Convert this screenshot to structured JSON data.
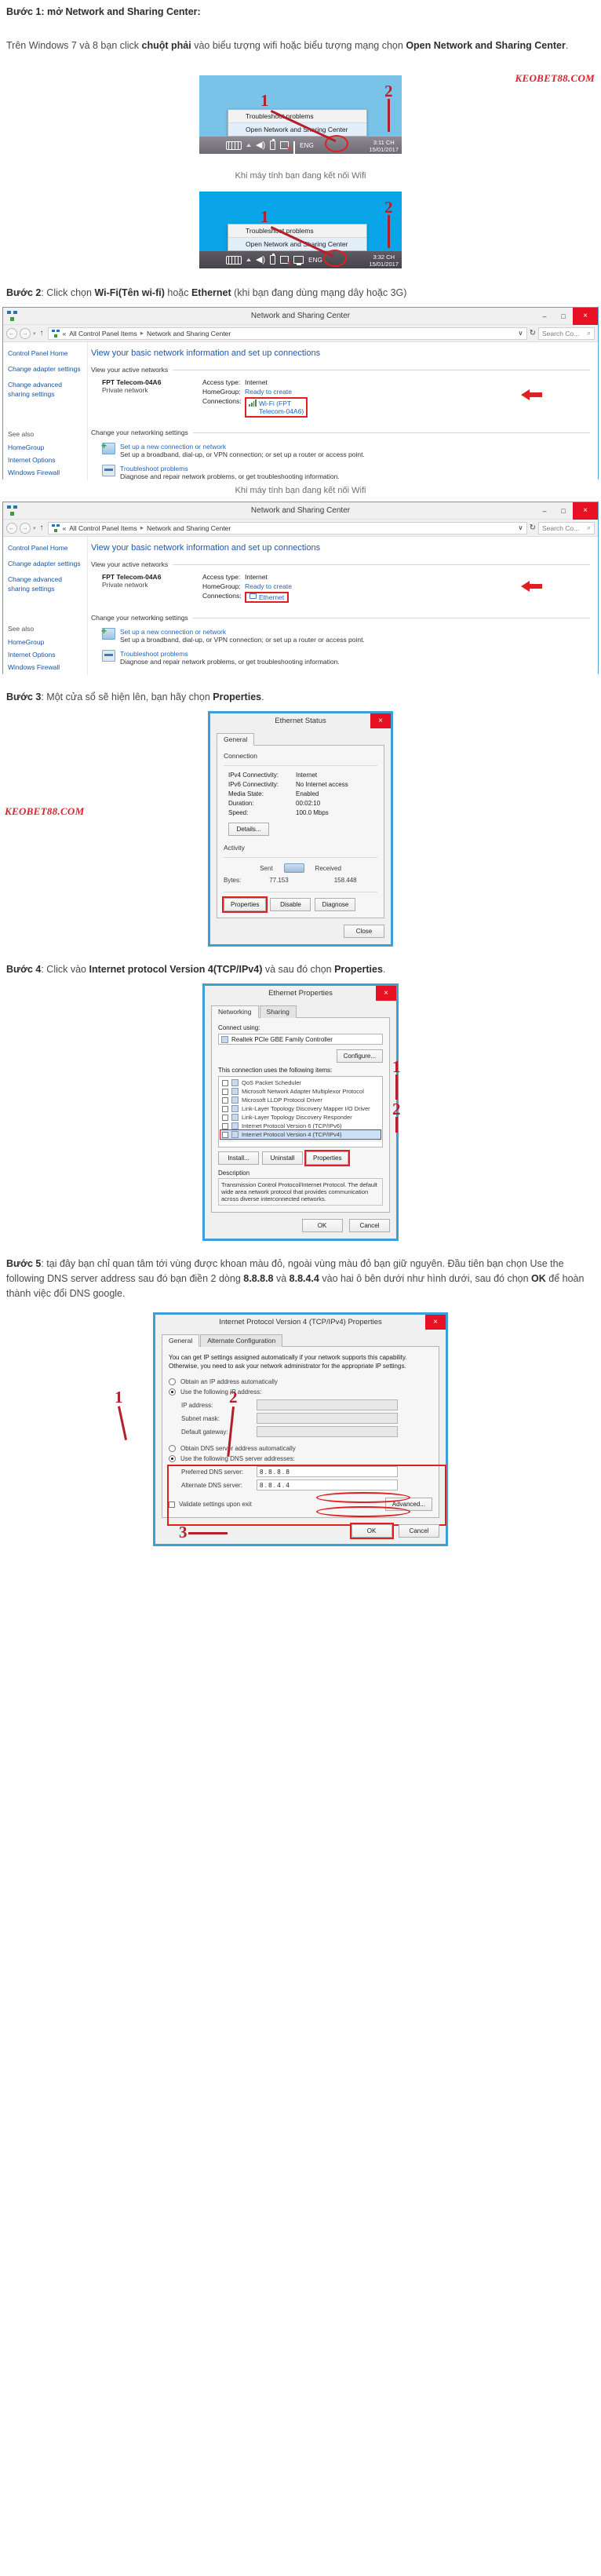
{
  "article": {
    "step1": {
      "label": "Bước 1",
      "title": ": mở Network and Sharing Center:",
      "body_pre": "Trên Windows 7 và 8 bạn click ",
      "body_bold1": "chuột phải",
      "body_mid": " vào biểu tượng wifi hoặc biểu tượng mạng chọn ",
      "body_bold2": "Open Network and Sharing Center",
      "body_end": "."
    },
    "step2": {
      "label": "Bước 2",
      "t1": ": Click chọn ",
      "b1": "Wi-Fi(Tên wi-fi)",
      "t2": " hoặc ",
      "b2": "Ethernet",
      "t3": " (khi bạn đang dùng mạng dây hoặc 3G)"
    },
    "step3": {
      "label": "Bước 3",
      "t1": ": Một cửa sổ sẽ hiện lên, bạn hãy chọn ",
      "b1": "Properties",
      "t2": "."
    },
    "step4": {
      "label": "Bước 4",
      "t1": ": Click vào ",
      "b1": "Internet protocol Version 4(TCP/IPv4)",
      "t2": " và sau đó chọn ",
      "b2": "Properties",
      "t3": "."
    },
    "step5": {
      "label": "Bước 5",
      "t1": ": tại đây bạn chỉ quan tâm tới vùng được khoan màu đỏ, ngoài vùng màu đỏ bạn giữ nguyên. Đầu tiên bạn chọn Use the following DNS server address sau đó bạn điền 2 dòng ",
      "b1": "8.8.8.8",
      "t2": " và ",
      "b2": "8.8.4.4",
      "t3": " vào hai ô bên dưới như hình dưới, sau đó chọn ",
      "b3": "OK",
      "t4": " để hoàn thành việc đổi DNS google."
    }
  },
  "watermark": {
    "text": "KEOBET88.COM"
  },
  "taskbar_wifi": {
    "markers": {
      "one": "1",
      "two": "2"
    },
    "menu": [
      {
        "label": "Troubleshoot problems",
        "selected": false
      },
      {
        "label": "Open Network and Sharing Center",
        "selected": true
      }
    ],
    "lang": "ENG",
    "time": "3:11 CH",
    "date": "15/01/2017",
    "caption": "Khi máy tính bạn đang kết nối Wifi"
  },
  "taskbar_eth": {
    "markers": {
      "one": "1",
      "two": "2"
    },
    "menu": [
      {
        "label": "Troubleshoot problems",
        "selected": false
      },
      {
        "label": "Open Network and Sharing Center",
        "selected": true
      }
    ],
    "lang": "ENG",
    "time": "3:32 CH",
    "date": "15/01/2017"
  },
  "nsc_window": {
    "title": "Network and Sharing Center",
    "buttons": {
      "min": "–",
      "max": "□",
      "close": "×"
    },
    "nav": {
      "back": "←",
      "fwd": "→",
      "history": "▾",
      "up": "↑"
    },
    "breadcrumb": {
      "chev": "«",
      "item1": "All Control Panel Items",
      "sep": "▸",
      "item2": "Network and Sharing Center",
      "dropdown": "∨",
      "refresh": "↻"
    },
    "search": {
      "placeholder": "Search Co...",
      "icon": "⌕"
    },
    "left_links": [
      "Control Panel Home",
      "Change adapter settings",
      "Change advanced sharing settings"
    ],
    "see_also_heading": "See also",
    "see_also_links": [
      "HomeGroup",
      "Internet Options",
      "Windows Firewall"
    ],
    "heading": "View your basic network information and set up connections",
    "section_active": "View your active networks",
    "network_name": "FPT Telecom-04A6",
    "network_type": "Private network",
    "access_key": "Access type:",
    "access_value": "Internet",
    "homegroup_key": "HomeGroup:",
    "homegroup_value": "Ready to create",
    "connections_key": "Connections:",
    "connection_wifi_line1": "Wi-Fi (FPT",
    "connection_wifi_line2": "Telecom-04A6)",
    "connection_eth": "Ethernet",
    "section_change": "Change your networking settings",
    "item1_title": "Set up a new connection or network",
    "item1_desc": "Set up a broadband, dial-up, or VPN connection; or set up a router or access point.",
    "item2_title": "Troubleshoot problems",
    "item2_desc": "Diagnose and repair network problems, or get troubleshooting information.",
    "caption_wifi": "Khi máy tính bạn đang kết nối Wifi"
  },
  "ethernet_status": {
    "title": "Ethernet Status",
    "close": "×",
    "tab_general": "General",
    "connection_heading": "Connection",
    "rows": [
      {
        "k": "IPv4 Connectivity:",
        "v": "Internet"
      },
      {
        "k": "IPv6 Connectivity:",
        "v": "No Internet access"
      },
      {
        "k": "Media State:",
        "v": "Enabled"
      },
      {
        "k": "Duration:",
        "v": "00:02:10"
      },
      {
        "k": "Speed:",
        "v": "100.0 Mbps"
      }
    ],
    "details_btn": "Details...",
    "activity_heading": "Activity",
    "sent_label": "Sent",
    "received_label": "Received",
    "bytes_label": "Bytes:",
    "bytes_sent": "77.153",
    "bytes_received": "158.448",
    "btn_properties": "Properties",
    "btn_disable": "Disable",
    "btn_diagnose": "Diagnose",
    "btn_close": "Close"
  },
  "ethernet_properties": {
    "title": "Ethernet Properties",
    "close": "×",
    "tab_networking": "Networking",
    "tab_sharing": "Sharing",
    "connect_label": "Connect using:",
    "adapter": "Realtek PCIe GBE Family Controller",
    "configure_btn": "Configure...",
    "items_label": "This connection uses the following items:",
    "items": [
      {
        "label": "QoS Packet Scheduler",
        "checked": true,
        "selected": false
      },
      {
        "label": "Microsoft Network Adapter Multiplexor Protocol",
        "checked": false,
        "selected": false
      },
      {
        "label": "Microsoft LLDP Protocol Driver",
        "checked": true,
        "selected": false
      },
      {
        "label": "Link-Layer Topology Discovery Mapper I/O Driver",
        "checked": true,
        "selected": false
      },
      {
        "label": "Link-Layer Topology Discovery Responder",
        "checked": true,
        "selected": false
      },
      {
        "label": "Internet Protocol Version 6 (TCP/IPv6)",
        "checked": true,
        "selected": false
      },
      {
        "label": "Internet Protocol Version 4 (TCP/IPv4)",
        "checked": true,
        "selected": true
      }
    ],
    "btn_install": "Install...",
    "btn_uninstall": "Uninstall",
    "btn_properties": "Properties",
    "desc_heading": "Description",
    "desc_text": "Transmission Control Protocol/Internet Protocol. The default wide area network protocol that provides communication across diverse interconnected networks.",
    "btn_ok": "OK",
    "btn_cancel": "Cancel",
    "marker_one": "1",
    "marker_two": "2"
  },
  "ipv4_properties": {
    "title": "Internet Protocol Version 4 (TCP/IPv4) Properties",
    "close": "×",
    "tab_general": "General",
    "tab_alternate": "Alternate Configuration",
    "intro": "You can get IP settings assigned automatically if your network supports this capability. Otherwise, you need to ask your network administrator for the appropriate IP settings.",
    "opt_auto_ip": "Obtain an IP address automatically",
    "opt_manual_ip": "Use the following IP address:",
    "lbl_ip": "IP address:",
    "lbl_subnet": "Subnet mask:",
    "lbl_gateway": "Default gateway:",
    "opt_auto_dns": "Obtain DNS server address automatically",
    "opt_manual_dns": "Use the following DNS server addresses:",
    "lbl_preferred": "Preferred DNS server:",
    "lbl_alternate": "Alternate DNS server:",
    "dns_preferred": "8 . 8 . 8 . 8",
    "dns_alternate": "8 . 8 . 4 . 4",
    "chk_validate": "Validate settings upon exit",
    "btn_advanced": "Advanced...",
    "btn_ok": "OK",
    "btn_cancel": "Cancel",
    "marker_one": "1",
    "marker_two": "2",
    "marker_three": "3"
  }
}
